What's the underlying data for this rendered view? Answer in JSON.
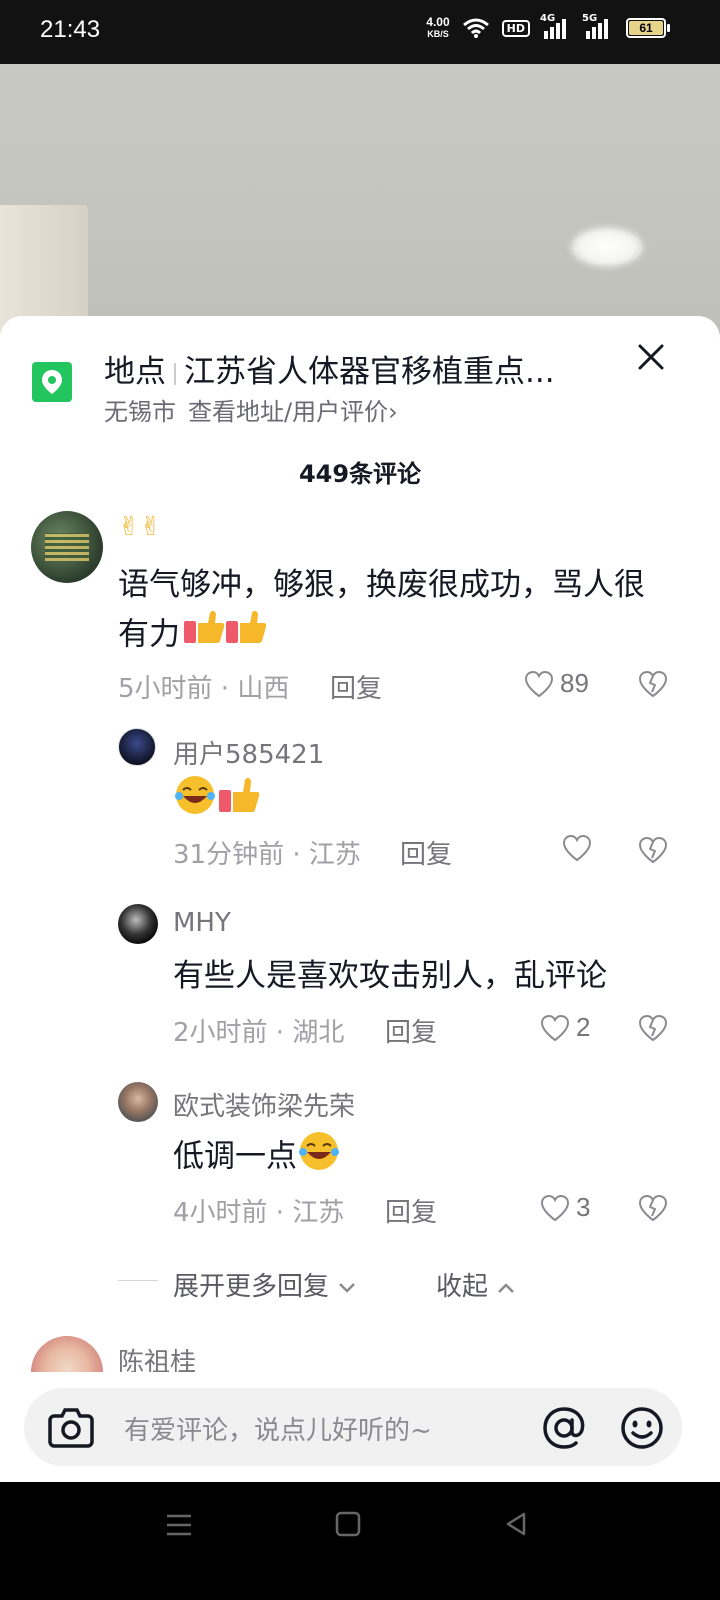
{
  "status_bar": {
    "time": "21:43",
    "network_speed": "4.00",
    "network_unit": "KB/S",
    "hd_label": "HD",
    "signal1_label": "4G",
    "signal2_label": "5G",
    "battery": "61"
  },
  "location": {
    "label": "地点",
    "name": "江苏省人体器官移植重点...",
    "city": "无锡市",
    "link": "查看地址/用户评价›"
  },
  "comment_count": "449条评论",
  "comments": [
    {
      "username": "✌✌",
      "text": "语气够冲，够狠，换废很成功，骂人很有力",
      "meta": "5小时前 · 山西",
      "reply_label": "回复",
      "likes": "89"
    }
  ],
  "replies": [
    {
      "username": "用户585421",
      "meta": "31分钟前 · 江苏",
      "reply_label": "回复",
      "likes": ""
    },
    {
      "username": "MHY",
      "text": "有些人是喜欢攻击别人，乱评论",
      "meta": "2小时前 · 湖北",
      "reply_label": "回复",
      "likes": "2"
    },
    {
      "username": "欧式装饰梁先荣",
      "text": "低调一点",
      "meta": "4小时前 · 江苏",
      "reply_label": "回复",
      "likes": "3"
    }
  ],
  "expand_more": "展开更多回复",
  "collapse": "收起",
  "next_comment_username": "陈祖桂",
  "input": {
    "placeholder": "有爱评论，说点儿好听的~"
  },
  "icons": {
    "location": "location-pin-icon",
    "close": "close-icon",
    "like": "heart-icon",
    "dislike": "broken-heart-icon",
    "camera": "camera-icon",
    "mention": "at-icon",
    "emoji": "smiley-icon"
  },
  "colors": {
    "location_green": "#22c55e",
    "text_primary": "#161823",
    "text_secondary": "#75757c"
  }
}
